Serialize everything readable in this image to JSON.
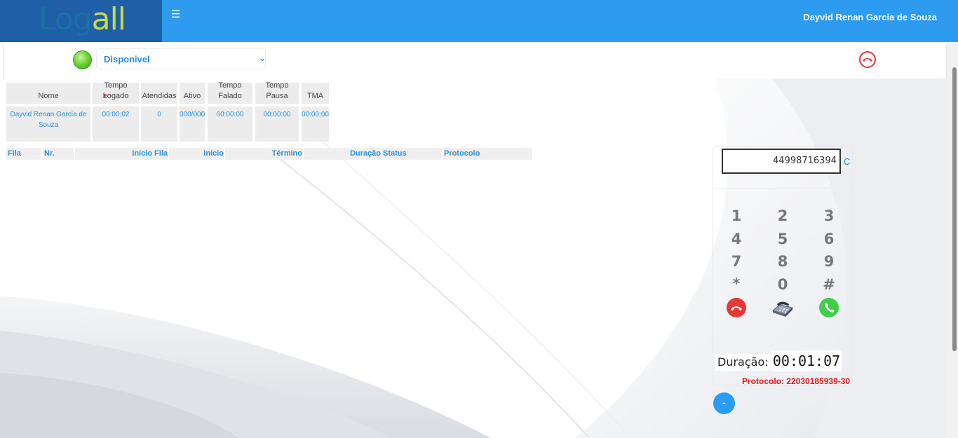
{
  "header": {
    "logo_text": "Logall",
    "user_name": "Dayvid Renan Garcia de Souza"
  },
  "status": {
    "selected": "Disponivel"
  },
  "stats": {
    "columns": [
      "Nome",
      "Tempo Logado",
      "Atendidas",
      "Ativo",
      "Tempo Falado",
      "Tempo Pausa",
      "TMA"
    ],
    "row": [
      "Dayvid Renan Garcia de Souza",
      "00:00:02",
      "0",
      "000/000",
      "00:00:00",
      "00:00:00",
      "00:00:00"
    ]
  },
  "calls": {
    "columns": [
      "Fila",
      "Nr.",
      "Início Fila",
      "Início",
      "Término",
      "Duração",
      "Status",
      "Protocolo"
    ]
  },
  "phone": {
    "number": "44998716394",
    "clear_label": "C",
    "keys": [
      "1",
      "2",
      "3",
      "4",
      "5",
      "6",
      "7",
      "8",
      "9",
      "*",
      "0",
      "#"
    ],
    "duration_label": "Duração:",
    "duration_value": "00:01:07",
    "protocol": "Protocolo: 22030185939-30",
    "minus_label": "-"
  },
  "icons": {
    "menu": "hamburger-icon",
    "hangup": "phone-hangup-icon",
    "call": "phone-call-icon",
    "telephone": "telephone-icon"
  },
  "colors": {
    "topbar": "#2d9bef",
    "logo_bg": "#1f5fa8",
    "accent_text": "#2d8fd6",
    "hangup": "#e53935",
    "call": "#3fcf4b",
    "protocol": "#e01b1b"
  }
}
